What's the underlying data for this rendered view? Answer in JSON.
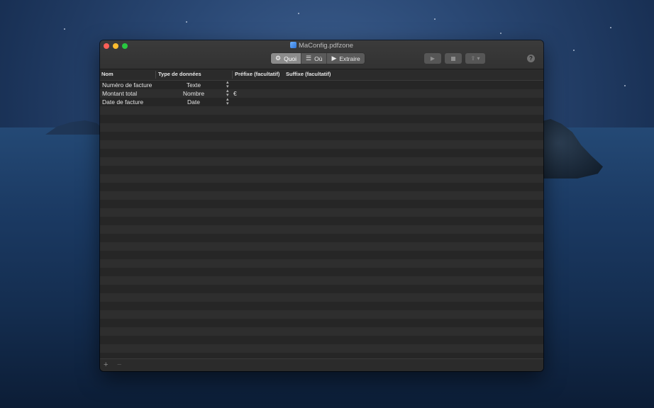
{
  "window": {
    "title": "MaConfig.pdfzone"
  },
  "toolbar": {
    "segments": [
      {
        "label": "Quoi",
        "icon": "gear-icon",
        "active": true
      },
      {
        "label": "Où",
        "icon": "list-icon",
        "active": false
      },
      {
        "label": "Extraire",
        "icon": "play-icon",
        "active": false
      }
    ],
    "run_icon": "play-icon",
    "stop_icon": "stop-icon",
    "share_icon": "share-icon",
    "help_label": "?"
  },
  "table": {
    "columns": [
      "Nom",
      "Type de données",
      "Préfixe (facultatif)",
      "Suffixe (facultatif)"
    ],
    "rows": [
      {
        "name": "Numéro de facture",
        "type": "Texte",
        "prefix": "",
        "suffix": ""
      },
      {
        "name": "Montant total",
        "type": "Nombre",
        "prefix": "€",
        "suffix": ""
      },
      {
        "name": "Date de facture",
        "type": "Date",
        "prefix": "",
        "suffix": ""
      }
    ]
  },
  "footer": {
    "add_label": "+",
    "remove_label": "−"
  },
  "colors": {
    "window_bg": "#262626",
    "row_alt": "#2e2e2e",
    "segment_active": "#8b8b8b"
  }
}
